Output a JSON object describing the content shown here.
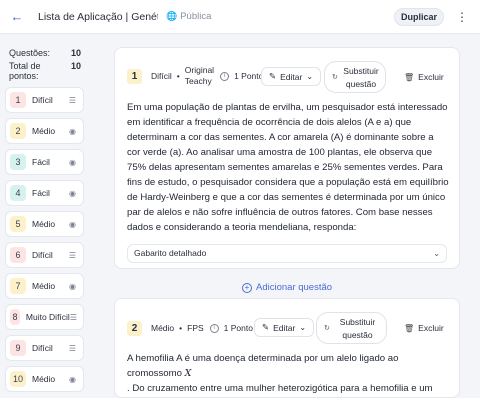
{
  "header": {
    "back_icon": "arrow-left-icon",
    "title": "Lista de Aplicação | Genéti...",
    "visibility_icon": "globe-icon",
    "visibility": "Pública",
    "duplicate_label": "Duplicar",
    "more_icon": "kebab-menu-icon"
  },
  "sidebar": {
    "questions_label": "Questões:",
    "questions_count": "10",
    "points_label": "Total de pontos:",
    "points_count": "10",
    "items": [
      {
        "num": "1",
        "label": "Difícil",
        "icon": "lines-icon"
      },
      {
        "num": "2",
        "label": "Médio",
        "icon": "radio-icon"
      },
      {
        "num": "3",
        "label": "Fácil",
        "icon": "radio-icon"
      },
      {
        "num": "4",
        "label": "Fácil",
        "icon": "radio-icon"
      },
      {
        "num": "5",
        "label": "Médio",
        "icon": "radio-icon"
      },
      {
        "num": "6",
        "label": "Difícil",
        "icon": "lines-icon"
      },
      {
        "num": "7",
        "label": "Médio",
        "icon": "radio-icon"
      },
      {
        "num": "8",
        "label": "Muito Difícil",
        "icon": "lines-icon"
      },
      {
        "num": "9",
        "label": "Difícil",
        "icon": "lines-icon"
      },
      {
        "num": "10",
        "label": "Médio",
        "icon": "radio-icon"
      }
    ]
  },
  "question1": {
    "num": "1",
    "difficulty": "Difícil",
    "source_line1": "Original",
    "source_line2": "Teachy",
    "points": "1 Ponto",
    "edit_label": "Editar",
    "substitute_label": "Substituir questão",
    "delete_label": "Excluir",
    "text": "Em uma população de plantas de ervilha, um pesquisador está interessado em identificar a frequência de ocorrência de dois alelos (A e a) que determinam a cor das sementes. A cor amarela (A) é dominante sobre a cor verde (a). Ao analisar uma amostra de 100 plantas, ele observa que 75% delas apresentam sementes amarelas e 25% sementes verdes. Para fins de estudo, o pesquisador considera que a população está em equilíbrio de Hardy-Weinberg e que a cor das sementes é determinada por um único par de alelos e não sofre influência de outros fatores. Com base nesses dados e considerando a teoria mendeliana, responda:",
    "answer_key_label": "Gabarito detalhado"
  },
  "add_question_label": "Adicionar questão",
  "question2": {
    "num": "2",
    "difficulty": "Médio",
    "source": "FPS",
    "points": "1 Ponto",
    "edit_label": "Editar",
    "substitute_label": "Substituir questão",
    "delete_label": "Excluir",
    "text_part1": "A hemofilia A é uma doença determinada por um alelo ligado ao cromossomo",
    "text_var": "X",
    "text_part2": ". Do cruzamento entre uma mulher heterozigótica para a hemofilia e um"
  }
}
